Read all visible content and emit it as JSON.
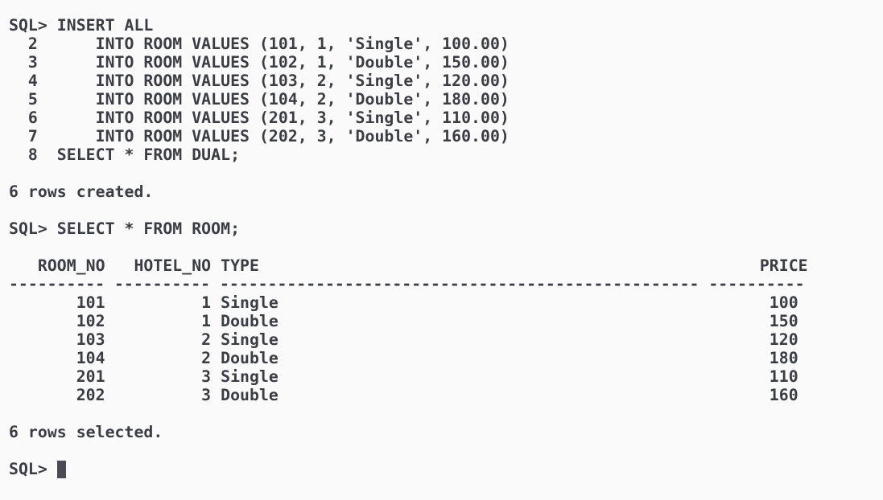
{
  "terminal": {
    "insert_block": [
      "SQL> INSERT ALL",
      "  2      INTO ROOM VALUES (101, 1, 'Single', 100.00)",
      "  3      INTO ROOM VALUES (102, 1, 'Double', 150.00)",
      "  4      INTO ROOM VALUES (103, 2, 'Single', 120.00)",
      "  5      INTO ROOM VALUES (104, 2, 'Double', 180.00)",
      "  6      INTO ROOM VALUES (201, 3, 'Single', 110.00)",
      "  7      INTO ROOM VALUES (202, 3, 'Double', 160.00)",
      "  8  SELECT * FROM DUAL;"
    ],
    "insert_feedback": "6 rows created.",
    "select_command": "SQL> SELECT * FROM ROOM;",
    "result_header": "   ROOM_NO   HOTEL_NO TYPE                                                    PRICE",
    "result_separator": "---------- ---------- -------------------------------------------------- ----------",
    "result_rows": [
      "       101          1 Single                                                   100",
      "       102          1 Double                                                   150",
      "       103          2 Single                                                   120",
      "       104          2 Double                                                   180",
      "       201          3 Single                                                   110",
      "       202          3 Double                                                   160"
    ],
    "select_feedback": "6 rows selected.",
    "prompt": "SQL> "
  }
}
